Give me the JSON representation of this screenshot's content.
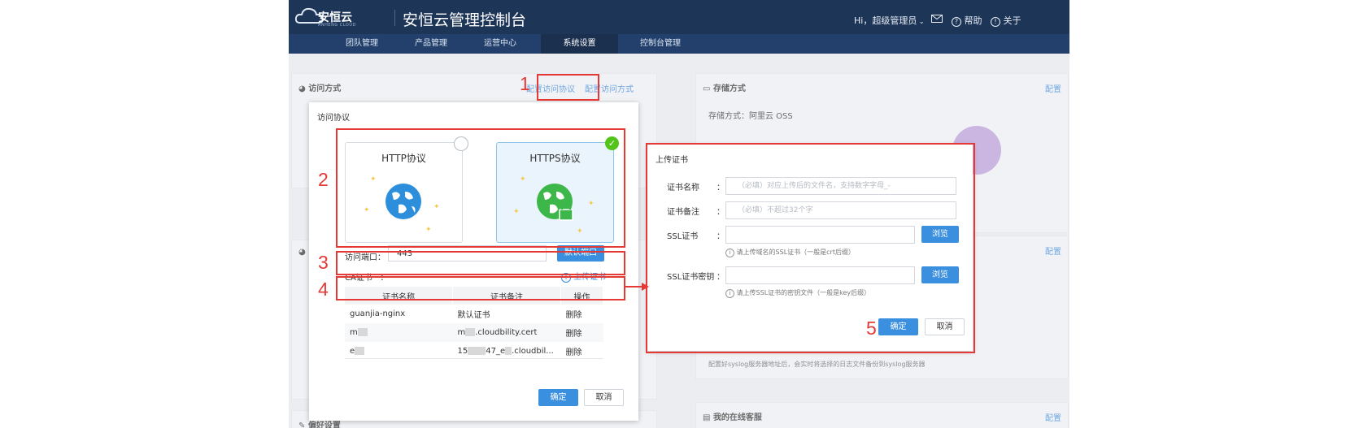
{
  "header": {
    "logo_text": "安恒云",
    "logo_sub": "ANHENG CLOUD",
    "app_title": "安恒云管理控制台",
    "greeting": "Hi，超级管理员",
    "help": "帮助",
    "about": "关于"
  },
  "nav": {
    "items": [
      "团队管理",
      "产品管理",
      "运营中心",
      "系统设置",
      "控制台管理"
    ],
    "active_index": 3
  },
  "background": {
    "access_panel": {
      "title": "访问方式",
      "link_protocol": "配置访问协议",
      "link_method": "配置访问方式"
    },
    "storage_panel": {
      "title": "存储方式",
      "config": "配置",
      "storage_label": "存储方式：阿里云 OSS"
    },
    "syslog_note": "配置好syslog服务器地址后，会实时将选择的日志文件备份到syslog服务器",
    "online_panel": {
      "title": "我的在线客服",
      "config": "配置"
    },
    "side_config": "配置",
    "bottom_left_title": "偏好设置"
  },
  "access_dialog": {
    "title": "访问协议",
    "http_label": "HTTP协议",
    "https_label": "HTTPS协议",
    "port_label": "访问端口：",
    "port_value": "443",
    "default_port_button": "默认端口",
    "ca_label": "CA证书",
    "ca_colon": "：",
    "upload_link": "上传证书",
    "table": {
      "headers": [
        "证书名称",
        "证书备注",
        "操作"
      ],
      "rows": [
        {
          "name": "guanjia-nginx",
          "note": "默认证书",
          "action": "删除"
        },
        {
          "name": "m",
          "note_prefix": "m",
          "note": ".cloudbility.cert",
          "action": "删除"
        },
        {
          "name": "e",
          "note_prefix": "15",
          "note_mid": "47_e",
          "note": ".cloudbil...",
          "action": "删除"
        }
      ]
    },
    "ok": "确定",
    "cancel": "取消"
  },
  "upload_dialog": {
    "title": "上传证书",
    "fields": [
      {
        "label": "证书名称",
        "colon": "：",
        "placeholder": "（必填）对应上传后的文件名，支持数字字母_-"
      },
      {
        "label": "证书备注",
        "colon": "：",
        "placeholder": "（必填）不超过32个字"
      },
      {
        "label": "SSL证书",
        "colon": "：",
        "placeholder": "",
        "browse": "浏览",
        "hint": "请上传域名的SSL证书（一般是crt后缀）"
      },
      {
        "label": "SSL证书密钥",
        "colon": "：",
        "placeholder": "",
        "browse": "浏览",
        "hint": "请上传SSL证书的密钥文件（一般是key后缀）"
      }
    ],
    "ok": "确定",
    "cancel": "取消"
  },
  "annotations": [
    "1",
    "2",
    "3",
    "4",
    "5"
  ],
  "colors": {
    "header": "#1d3557",
    "nav": "#22406b",
    "accent": "#3a8fde",
    "annotation": "#e53935",
    "check": "#52c41a"
  }
}
